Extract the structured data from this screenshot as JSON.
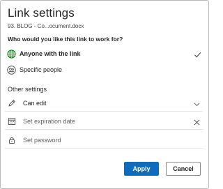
{
  "dialog": {
    "title": "Link settings",
    "subtitle": "93. BLOG - Co...ocument.docx",
    "question": "Who would you like this link to work for?"
  },
  "access_options": [
    {
      "label": "Anyone with the link",
      "icon": "globe-icon",
      "selected": true
    },
    {
      "label": "Specific people",
      "icon": "people-icon",
      "selected": false
    }
  ],
  "other_settings": {
    "title": "Other settings",
    "permission": {
      "label": "Can edit",
      "icon": "pencil-icon"
    },
    "expiration": {
      "placeholder": "Set expiration date",
      "icon": "calendar-icon"
    },
    "password": {
      "placeholder": "Set password",
      "icon": "lock-icon"
    }
  },
  "buttons": {
    "apply": "Apply",
    "cancel": "Cancel"
  },
  "colors": {
    "accent": "#0f6cbd",
    "selected_icon": "#107c10"
  }
}
